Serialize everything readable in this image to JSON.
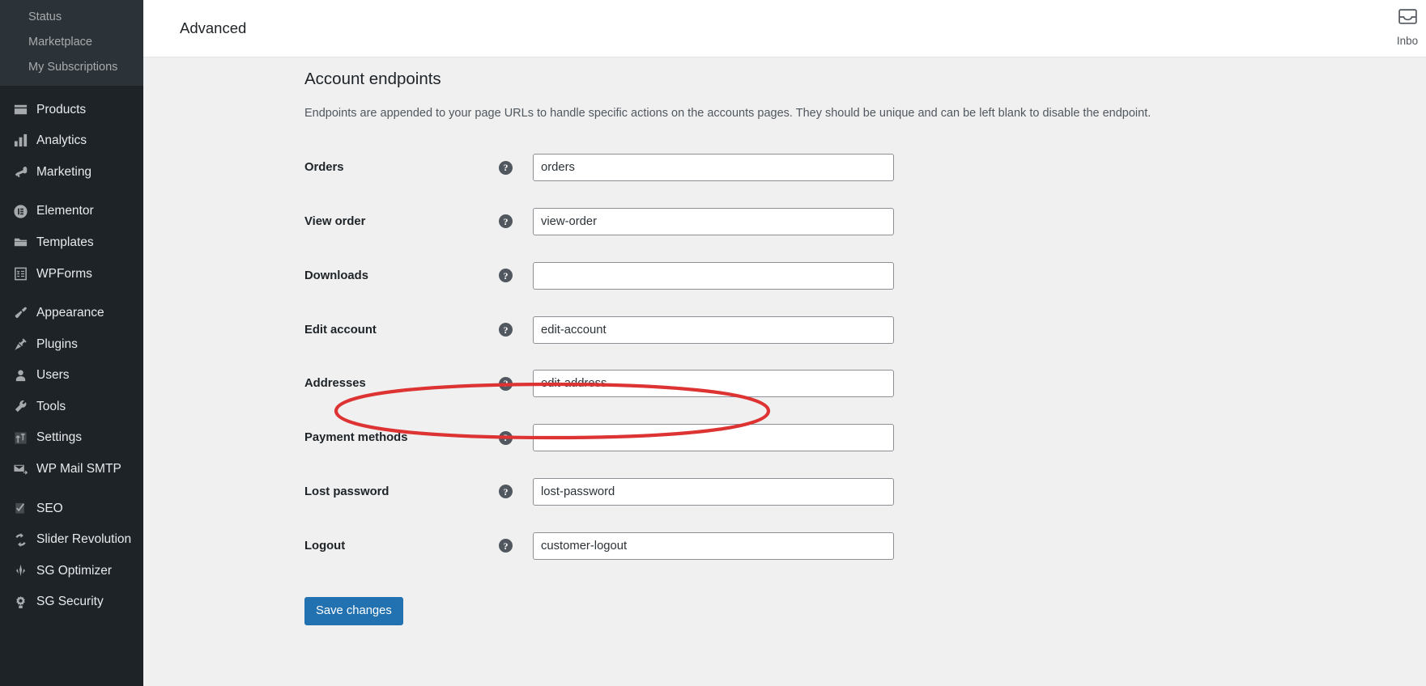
{
  "sidebar": {
    "submenu_items": [
      {
        "label": "Status",
        "name": "sidebar-subitem-status"
      },
      {
        "label": "Marketplace",
        "name": "sidebar-subitem-marketplace"
      },
      {
        "label": "My Subscriptions",
        "name": "sidebar-subitem-my-subscriptions"
      }
    ],
    "menu_items": [
      {
        "label": "Products",
        "icon": "products-icon"
      },
      {
        "label": "Analytics",
        "icon": "analytics-icon"
      },
      {
        "label": "Marketing",
        "icon": "megaphone-icon"
      },
      {
        "label": "Elementor",
        "icon": "elementor-icon"
      },
      {
        "label": "Templates",
        "icon": "folder-icon"
      },
      {
        "label": "WPForms",
        "icon": "wpforms-icon"
      },
      {
        "label": "Appearance",
        "icon": "paintbrush-icon"
      },
      {
        "label": "Plugins",
        "icon": "plug-icon"
      },
      {
        "label": "Users",
        "icon": "user-icon"
      },
      {
        "label": "Tools",
        "icon": "wrench-icon"
      },
      {
        "label": "Settings",
        "icon": "sliders-icon"
      },
      {
        "label": "WP Mail SMTP",
        "icon": "mail-forward-icon"
      },
      {
        "label": "SEO",
        "icon": "yoast-icon"
      },
      {
        "label": "Slider Revolution",
        "icon": "refresh-icon"
      },
      {
        "label": "SG Optimizer",
        "icon": "siteground-icon"
      },
      {
        "label": "SG Security",
        "icon": "shield-gear-icon"
      }
    ]
  },
  "topbar": {
    "title": "Advanced",
    "inbox_label": "Inbo",
    "inbox_icon": "inbox-icon"
  },
  "page": {
    "section_title": "Account endpoints",
    "description": "Endpoints are appended to your page URLs to handle specific actions on the accounts pages. They should be unique and can be left blank to disable the endpoint.",
    "save_label": "Save changes"
  },
  "fields": [
    {
      "label": "Orders",
      "value": "orders",
      "name": "orders"
    },
    {
      "label": "View order",
      "value": "view-order",
      "name": "view-order"
    },
    {
      "label": "Downloads",
      "value": "",
      "name": "downloads"
    },
    {
      "label": "Edit account",
      "value": "edit-account",
      "name": "edit-account"
    },
    {
      "label": "Addresses",
      "value": "edit-address",
      "name": "addresses"
    },
    {
      "label": "Payment methods",
      "value": "",
      "name": "payment-methods"
    },
    {
      "label": "Lost password",
      "value": "lost-password",
      "name": "lost-password"
    },
    {
      "label": "Logout",
      "value": "customer-logout",
      "name": "logout"
    }
  ],
  "annotation": {
    "type": "ellipse-highlight",
    "color": "#dd3333",
    "target": "payment-methods"
  },
  "colors": {
    "sidebar_bg": "#1d2327",
    "submenu_bg": "#2c3338",
    "content_bg": "#f0f0f1",
    "primary_button": "#2271b1",
    "annotation": "#dd3333"
  }
}
